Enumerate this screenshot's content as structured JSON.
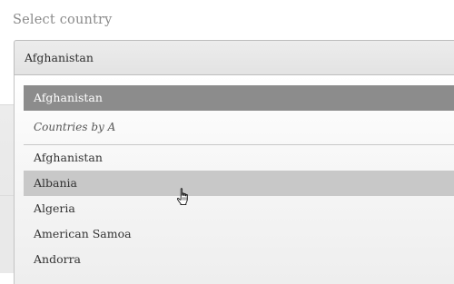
{
  "field": {
    "label": "Select country",
    "selected_value": "Afghanistan"
  },
  "dropdown": {
    "selected_item": "Afghanistan",
    "group_label": "Countries by A",
    "options": [
      {
        "label": "Afghanistan",
        "state": "normal"
      },
      {
        "label": "Albania",
        "state": "hover"
      },
      {
        "label": "Algeria",
        "state": "normal"
      },
      {
        "label": "American Samoa",
        "state": "normal"
      },
      {
        "label": "Andorra",
        "state": "normal"
      }
    ]
  },
  "colors": {
    "selected_bg": "#8c8c8c",
    "hover_bg": "#c8c8c8",
    "text": "#333333",
    "label_text": "#8a8a8a"
  },
  "cursor": {
    "type": "hand-pointer-icon"
  }
}
